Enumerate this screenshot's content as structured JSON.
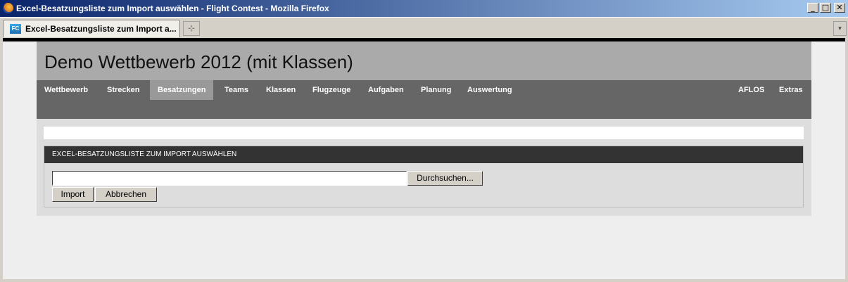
{
  "window": {
    "title": "Excel-Besatzungsliste zum Import auswählen - Flight Contest - Mozilla Firefox",
    "controls": {
      "minimize": "_",
      "maximize": "□",
      "close": "✕"
    }
  },
  "tabs": {
    "active_label": "Excel-Besatzungsliste zum Import a...",
    "favicon_text": "FC",
    "new_tab_glyph": "⊹",
    "list_glyph": "▾"
  },
  "page": {
    "heading": "Demo Wettbewerb 2012 (mit Klassen)",
    "nav": {
      "items": [
        "Wettbewerb",
        "Strecken",
        "Besatzungen",
        "Teams",
        "Klassen",
        "Flugzeuge",
        "Aufgaben",
        "Planung",
        "Auswertung"
      ],
      "right_items": [
        "AFLOS",
        "Extras"
      ],
      "active": "Besatzungen"
    },
    "message": "",
    "form": {
      "heading": "EXCEL-BESATZUNGSLISTE ZUM IMPORT AUSWÄHLEN",
      "file_value": "",
      "browse_label": "Durchsuchen...",
      "import_label": "Import",
      "cancel_label": "Abbrechen"
    }
  }
}
